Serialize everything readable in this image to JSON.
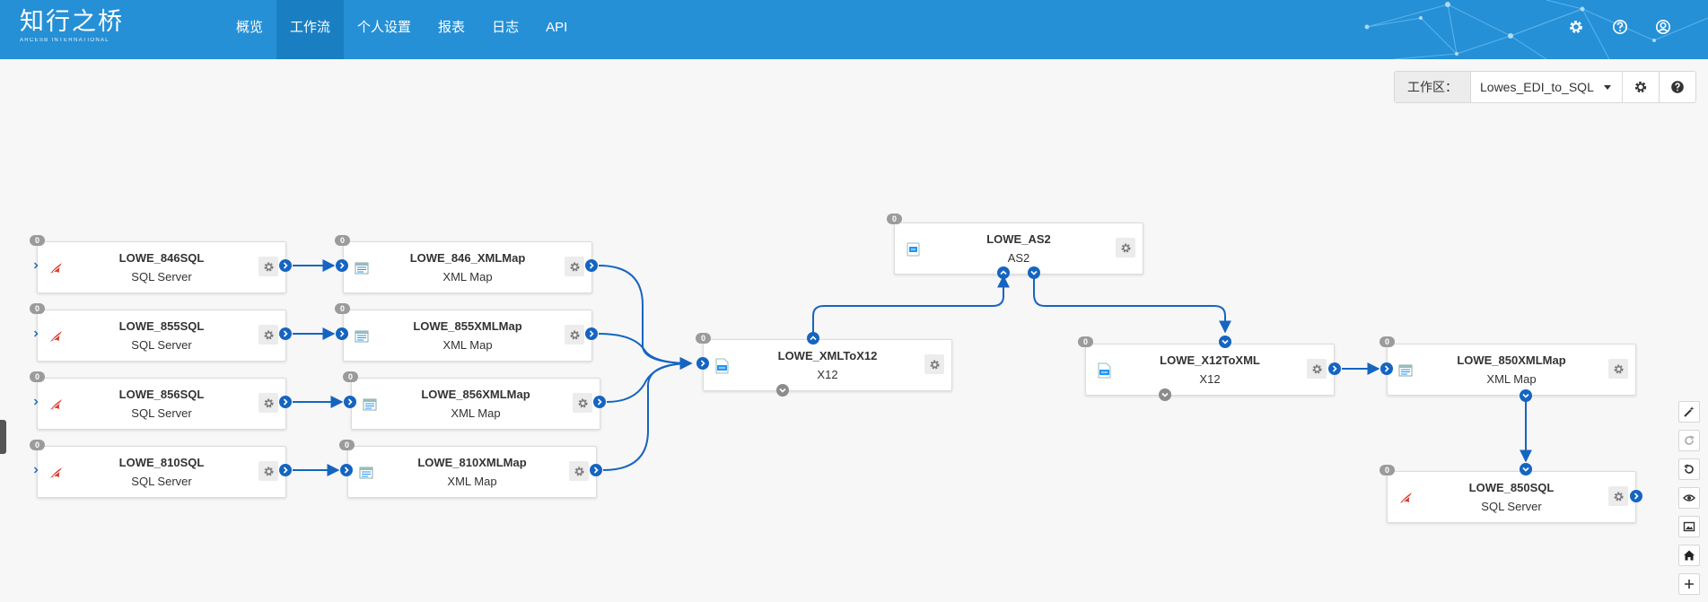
{
  "app": {
    "logo_text": "知行之桥",
    "logo_subtext": "ARCESB INTERNATIONAL"
  },
  "nav": {
    "items": [
      {
        "label": "概览",
        "active": false
      },
      {
        "label": "工作流",
        "active": true
      },
      {
        "label": "个人设置",
        "active": false
      },
      {
        "label": "报表",
        "active": false
      },
      {
        "label": "日志",
        "active": false
      },
      {
        "label": "API",
        "active": false
      }
    ],
    "icons": [
      "gear-icon",
      "help-icon",
      "user-icon"
    ]
  },
  "workspace": {
    "label": "工作区：",
    "selected": "Lowes_EDI_to_SQL",
    "buttons": [
      "gear-icon",
      "help-icon"
    ]
  },
  "nodes": [
    {
      "id": "n846sql",
      "title": "LOWE_846SQL",
      "type": "SQL Server",
      "badge": "0",
      "icon": "sqlserver-icon"
    },
    {
      "id": "n855sql",
      "title": "LOWE_855SQL",
      "type": "SQL Server",
      "badge": "0",
      "icon": "sqlserver-icon"
    },
    {
      "id": "n856sql",
      "title": "LOWE_856SQL",
      "type": "SQL Server",
      "badge": "0",
      "icon": "sqlserver-icon"
    },
    {
      "id": "n810sql",
      "title": "LOWE_810SQL",
      "type": "SQL Server",
      "badge": "0",
      "icon": "sqlserver-icon"
    },
    {
      "id": "n846map",
      "title": "LOWE_846_XMLMap",
      "type": "XML Map",
      "badge": "0",
      "icon": "xmlmap-icon"
    },
    {
      "id": "n855map",
      "title": "LOWE_855XMLMap",
      "type": "XML Map",
      "badge": "0",
      "icon": "xmlmap-icon"
    },
    {
      "id": "n856map",
      "title": "LOWE_856XMLMap",
      "type": "XML Map",
      "badge": "0",
      "icon": "xmlmap-icon"
    },
    {
      "id": "n810map",
      "title": "LOWE_810XMLMap",
      "type": "XML Map",
      "badge": "0",
      "icon": "xmlmap-icon"
    },
    {
      "id": "nxmltox12",
      "title": "LOWE_XMLToX12",
      "type": "X12",
      "badge": "0",
      "icon": "x12-icon"
    },
    {
      "id": "nas2",
      "title": "LOWE_AS2",
      "type": "AS2",
      "badge": "0",
      "icon": "as2-icon"
    },
    {
      "id": "nx12toxml",
      "title": "LOWE_X12ToXML",
      "type": "X12",
      "badge": "0",
      "icon": "x12-icon"
    },
    {
      "id": "n850map",
      "title": "LOWE_850XMLMap",
      "type": "XML Map",
      "badge": "0",
      "icon": "xmlmap-icon"
    },
    {
      "id": "n850sql",
      "title": "LOWE_850SQL",
      "type": "SQL Server",
      "badge": "0",
      "icon": "sqlserver-icon"
    }
  ],
  "connections": [
    [
      "n846sql",
      "n846map"
    ],
    [
      "n855sql",
      "n855map"
    ],
    [
      "n856sql",
      "n856map"
    ],
    [
      "n810sql",
      "n810map"
    ],
    [
      "n846map",
      "nxmltox12"
    ],
    [
      "n855map",
      "nxmltox12"
    ],
    [
      "n856map",
      "nxmltox12"
    ],
    [
      "n810map",
      "nxmltox12"
    ],
    [
      "nxmltox12",
      "nas2"
    ],
    [
      "nas2",
      "nx12toxml"
    ],
    [
      "nx12toxml",
      "n850map"
    ],
    [
      "n850map",
      "n850sql"
    ]
  ],
  "toolbar": {
    "tools": [
      "magic-wand-icon",
      "redo-icon",
      "undo-icon",
      "eye-icon",
      "image-icon",
      "home-icon",
      "zoom-in-icon"
    ]
  },
  "colors": {
    "header": "#2590d6",
    "active_nav": "#1a7fc2",
    "connector": "#1565c0",
    "badge": "#9b9b9b"
  }
}
